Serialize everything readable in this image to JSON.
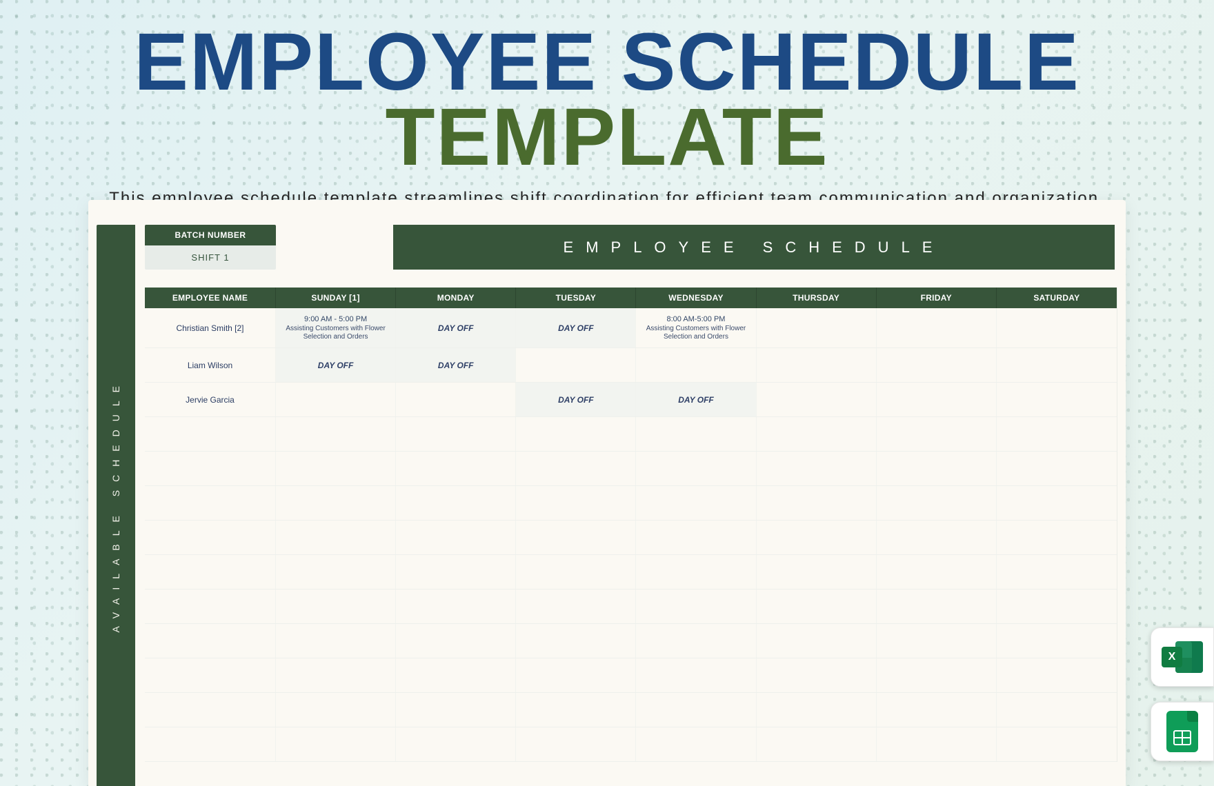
{
  "hero": {
    "title_part1": "EMPLOYEE SCHEDULE",
    "title_part2": "TEMPLATE",
    "subtitle": "This employee schedule template streamlines shift coordination for efficient team communication and organization."
  },
  "sidebar": {
    "label": "AVAILABLE  SCHEDULE"
  },
  "batch": {
    "header": "BATCH NUMBER",
    "value": "SHIFT 1"
  },
  "title_bar": "EMPLOYEE   SCHEDULE",
  "columns": [
    "EMPLOYEE NAME",
    "SUNDAY [1]",
    "MONDAY",
    "TUESDAY",
    "WEDNESDAY",
    "THURSDAY",
    "FRIDAY",
    "SATURDAY"
  ],
  "rows": [
    {
      "name": "Christian Smith [2]",
      "cells": [
        {
          "type": "task",
          "time": "9:00 AM - 5:00 PM",
          "desc": "Assisting Customers with Flower Selection and Orders",
          "shade": true
        },
        {
          "type": "dayoff",
          "shade": true
        },
        {
          "type": "dayoff",
          "shade": true
        },
        {
          "type": "task",
          "time": "8:00 AM-5:00 PM",
          "desc": "Assisting Customers with Flower Selection and Orders"
        },
        {
          "type": "blank"
        },
        {
          "type": "blank"
        },
        {
          "type": "blank"
        }
      ],
      "tall": true
    },
    {
      "name": "Liam Wilson",
      "cells": [
        {
          "type": "dayoff",
          "shade": true
        },
        {
          "type": "dayoff",
          "shade": true
        },
        {
          "type": "blank"
        },
        {
          "type": "blank"
        },
        {
          "type": "blank"
        },
        {
          "type": "blank"
        },
        {
          "type": "blank"
        }
      ]
    },
    {
      "name": "Jervie Garcia",
      "cells": [
        {
          "type": "blank"
        },
        {
          "type": "blank"
        },
        {
          "type": "dayoff",
          "shade": true
        },
        {
          "type": "dayoff",
          "shade": true
        },
        {
          "type": "blank"
        },
        {
          "type": "blank"
        },
        {
          "type": "blank"
        }
      ]
    }
  ],
  "empty_rows": 10,
  "labels": {
    "dayoff": "DAY OFF"
  },
  "badges": {
    "excel_letter": "X"
  }
}
